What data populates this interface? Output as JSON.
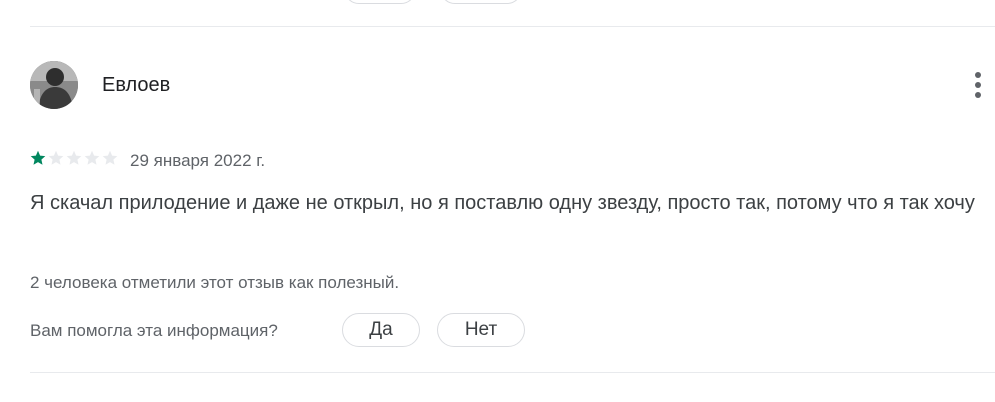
{
  "review": {
    "reviewer_name": "Евлоев",
    "rating": 1,
    "max_rating": 5,
    "date": "29 января 2022 г.",
    "text": "Я скачал прилодение и даже не открыл, но я поставлю одну звезду, просто так, потому что я так хочу",
    "helpful_count_text": "2 человека отметили этот отзыв как полезный.",
    "helpful_question": "Вам помогла эта информация?",
    "yes_label": "Да",
    "no_label": "Нет"
  },
  "icons": {
    "menu": "more-vert-icon",
    "star": "star-icon"
  },
  "colors": {
    "star_filled": "#01875f",
    "star_empty": "#e8eaed",
    "text_secondary": "#5f6368",
    "divider": "#e8eaed"
  }
}
